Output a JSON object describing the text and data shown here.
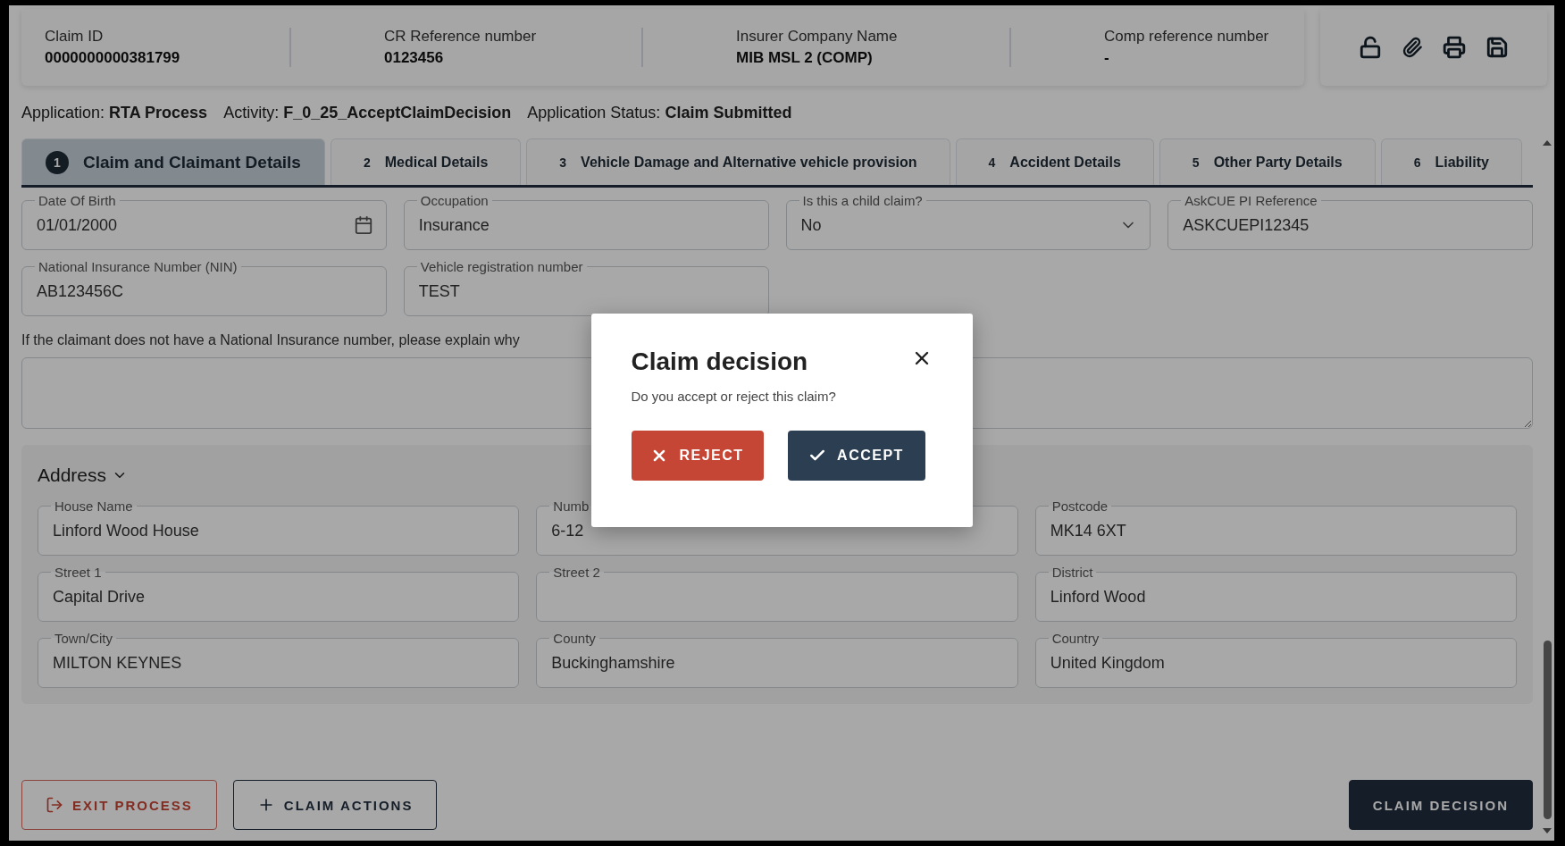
{
  "header": {
    "fields": [
      {
        "label": "Claim ID",
        "value": "0000000000381799"
      },
      {
        "label": "CR Reference number",
        "value": "0123456"
      },
      {
        "label": "Insurer Company Name",
        "value": "MIB MSL 2 (COMP)"
      },
      {
        "label": "Comp reference number",
        "value": "-"
      }
    ]
  },
  "status_line": [
    {
      "label": "Application:",
      "value": "RTA Process"
    },
    {
      "label": "Activity:",
      "value": "F_0_25_AcceptClaimDecision"
    },
    {
      "label": "Application Status:",
      "value": "Claim Submitted"
    }
  ],
  "tabs": [
    {
      "number": "1",
      "label": "Claim and Claimant Details",
      "selected": true
    },
    {
      "number": "2",
      "label": "Medical Details",
      "selected": false
    },
    {
      "number": "3",
      "label": "Vehicle Damage and Alternative vehicle provision",
      "selected": false
    },
    {
      "number": "4",
      "label": "Accident Details",
      "selected": false
    },
    {
      "number": "5",
      "label": "Other Party Details",
      "selected": false
    },
    {
      "number": "6",
      "label": "Liability",
      "selected": false
    }
  ],
  "claimant_fields": [
    {
      "label": "Date Of Birth",
      "value": "01/01/2000",
      "kind": "date"
    },
    {
      "label": "Occupation",
      "value": "Insurance",
      "kind": "text"
    },
    {
      "label": "Is this a child claim?",
      "value": "No",
      "kind": "select"
    },
    {
      "label": "AskCUE PI Reference",
      "value": "ASKCUEPI12345",
      "kind": "text"
    },
    {
      "label": "National Insurance Number (NIN)",
      "value": "AB123456C",
      "kind": "text"
    },
    {
      "label": "Vehicle registration number",
      "value": "TEST",
      "kind": "text"
    }
  ],
  "nin_explanation": {
    "label": "If the claimant does not have a National Insurance number, please explain why"
  },
  "address": {
    "title": "Address",
    "expanded": true,
    "fields": [
      {
        "label": "House Name",
        "value": "Linford Wood House"
      },
      {
        "label": "Numb",
        "value": "6-12"
      },
      {
        "label": "Postcode",
        "value": "MK14 6XT"
      },
      {
        "label": "Street 1",
        "value": "Capital Drive"
      },
      {
        "label": "Street 2"
      },
      {
        "label": "District",
        "value": "Linford Wood"
      },
      {
        "label": "Town/City",
        "value": "MILTON KEYNES"
      },
      {
        "label": "County",
        "value": "Buckinghamshire"
      },
      {
        "label": "Country",
        "value": "United Kingdom"
      }
    ]
  },
  "footer_buttons": [
    {
      "label": "EXIT PROCESS",
      "kind": "exit"
    },
    {
      "label": "CLAIM ACTIONS",
      "kind": "actions"
    },
    {
      "label": "CLAIM DECISION",
      "kind": "decision"
    }
  ],
  "dialog": {
    "title": "Claim decision",
    "message": "Do you accept or reject this claim?",
    "buttons": [
      {
        "label": "REJECT",
        "kind": "reject"
      },
      {
        "label": "ACCEPT",
        "kind": "accept"
      }
    ]
  }
}
